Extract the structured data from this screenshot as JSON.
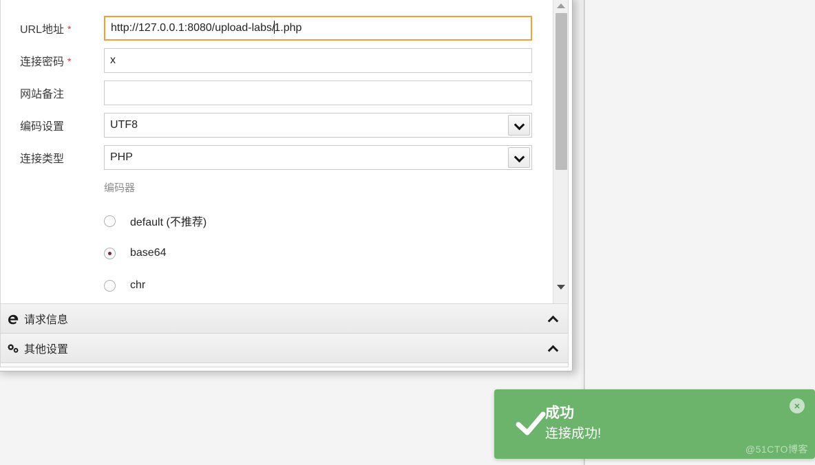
{
  "dialog": {
    "form": {
      "rows": [
        {
          "label": "URL地址",
          "required": true,
          "type": "text",
          "value": "http://127.0.0.1:8080/upload-labs/1.php",
          "caret_after": "http://127.0.0.1:8080/upload-labs/",
          "caret_rest": "1.php",
          "focused": true,
          "placeholder": ""
        },
        {
          "label": "连接密码",
          "required": true,
          "type": "text",
          "value": "x",
          "focused": false,
          "placeholder": ""
        },
        {
          "label": "网站备注",
          "required": false,
          "type": "text",
          "value": "",
          "focused": false,
          "placeholder": ""
        },
        {
          "label": "编码设置",
          "required": false,
          "type": "select",
          "value": "UTF8",
          "focused": false,
          "placeholder": ""
        },
        {
          "label": "连接类型",
          "required": false,
          "type": "select",
          "value": "PHP",
          "focused": false,
          "placeholder": ""
        }
      ],
      "required_marker": "*",
      "encoder": {
        "title": "编码器",
        "options": [
          {
            "label": "default (不推荐)",
            "checked": false
          },
          {
            "label": "base64",
            "checked": true
          },
          {
            "label": "chr",
            "checked": false
          }
        ]
      }
    },
    "scrollbar": {
      "up_icon": "triangle-up-icon",
      "down_icon": "triangle-down-icon"
    },
    "accordions": [
      {
        "icon": "edge-browser-icon",
        "glyph": "℮",
        "title": "请求信息",
        "collapse_icon": "chevron-up-icon"
      },
      {
        "icon": "cogs-icon",
        "glyph": "⚙",
        "title": "其他设置",
        "collapse_icon": "chevron-up-icon"
      }
    ]
  },
  "toast": {
    "status_color": "#6cb36c",
    "check_icon": "check-icon",
    "title": "成功",
    "message": "连接成功!",
    "close_label": "×",
    "watermark": "@51CTO博客"
  }
}
